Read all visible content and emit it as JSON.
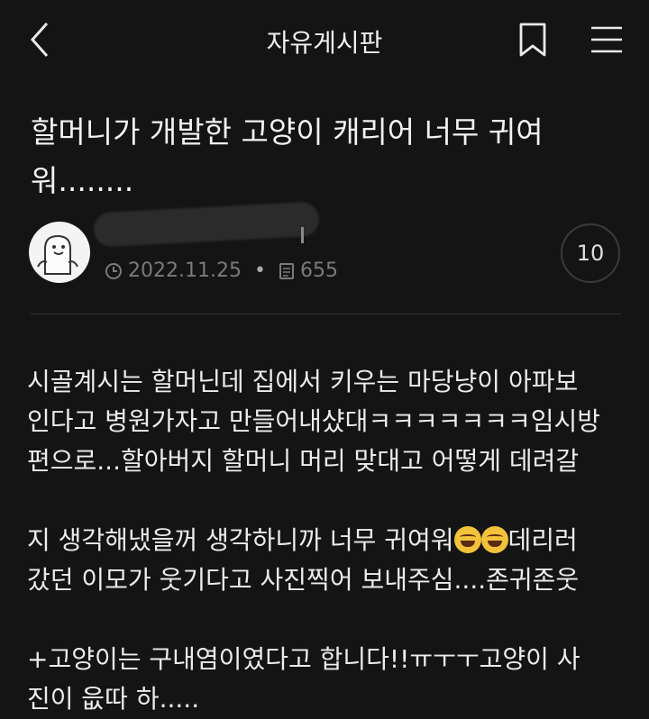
{
  "header": {
    "title": "자유게시판",
    "icons": [
      "back-arrow-icon",
      "bookmark-icon",
      "menu-icon"
    ]
  },
  "post": {
    "title": "할머니가 개발한 고양이 캐리어 너무 귀여워........",
    "date": "2022.11.25",
    "views": "655",
    "comment_count": "10",
    "body_lines": [
      "시골계시는 할머닌데 집에서 키우는 마당냥이 아파보",
      "인다고 병원가자고 만들어내샸대ㅋㅋㅋㅋㅋㅋㅋ임시방",
      "편으로...할아버지 할머니 머리 맞대고 어떻게 데려갈",
      "지 생각해냈을꺼 생각하니까 너무 귀여워",
      "데리러",
      "갔던 이모가 웃기다고 사진찍어 보내주심....존귀존웃",
      "+고양이는 구내염이였다고 합니다!!ㅠㅜㅜ고양이 사",
      "진이 읎따 하....."
    ]
  },
  "colors": {
    "background": "#141414",
    "text": "#ececec",
    "meta": "#7a7a7a"
  }
}
